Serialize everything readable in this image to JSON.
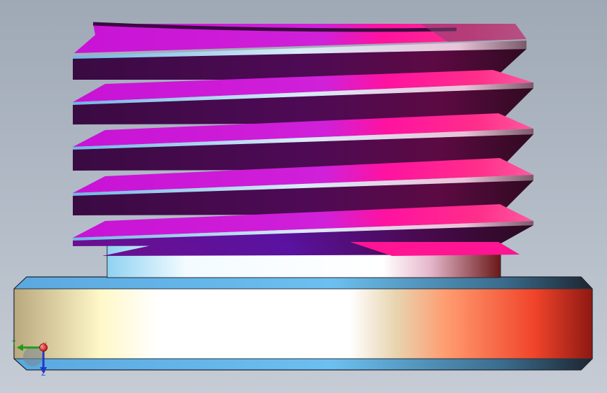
{
  "viewport": {
    "background_top": "#9fa9b5",
    "background_bottom": "#c6ccd5"
  },
  "model": {
    "thread_turns_visible": 5,
    "thread_colors": [
      "#c81edc",
      "#ff1493",
      "#3d0540",
      "#7a1fb0"
    ],
    "base_colors": [
      "#d7c58c",
      "#ffffff",
      "#ff6a3d",
      "#9c1a14"
    ],
    "bevel_color": "#5fb4ea"
  },
  "triad": {
    "x_label": "X",
    "y_label": "Y",
    "z_label": "Z",
    "x_color": "#d42020",
    "y_color": "#1f9a1f",
    "z_color": "#1f38c8"
  }
}
